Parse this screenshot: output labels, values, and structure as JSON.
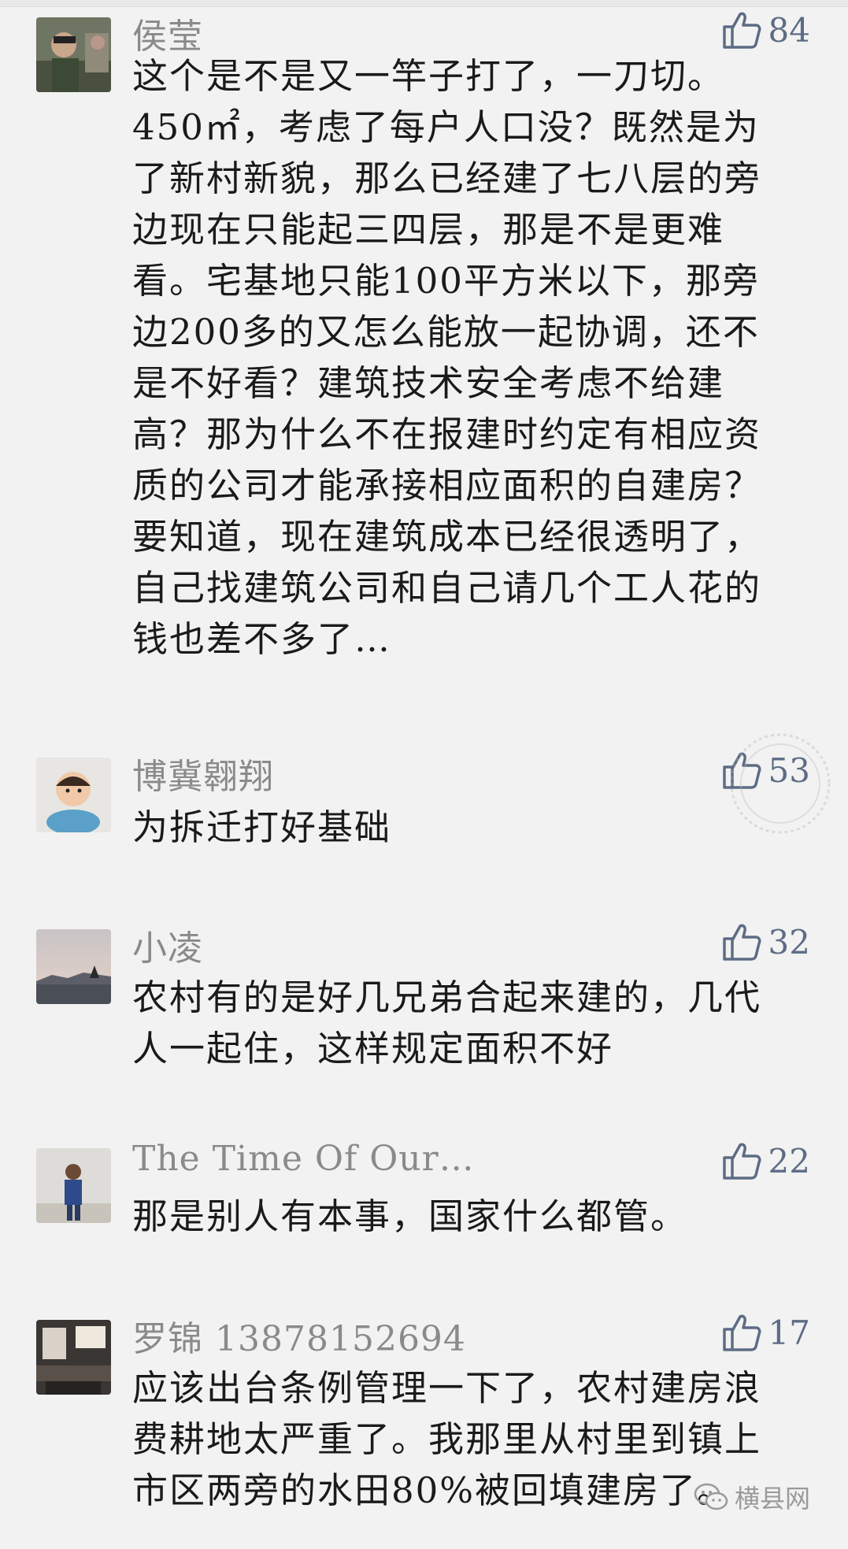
{
  "comments": [
    {
      "name": "侯莹",
      "likes": "84",
      "lines": [
        "这个是不是又一竿子打了，一刀切。",
        "450㎡，考虑了每户人口没？既然是为",
        "了新村新貌，那么已经建了七八层的旁",
        "边现在只能起三四层，那是不是更难",
        "看。宅基地只能100平方米以下，那旁",
        "边200多的又怎么能放一起协调，还不",
        "是不好看？建筑技术安全考虑不给建",
        "高？那为什么不在报建时约定有相应资",
        "质的公司才能承接相应面积的自建房？",
        "要知道，现在建筑成本已经很透明了，",
        "自己找建筑公司和自己请几个工人花的",
        "钱也差不多了…"
      ]
    },
    {
      "name": "博冀翱翔",
      "likes": "53",
      "lines": [
        "为拆迁打好基础"
      ]
    },
    {
      "name": "小凌",
      "likes": "32",
      "lines": [
        "农村有的是好几兄弟合起来建的，几代",
        "人一起住，这样规定面积不好"
      ]
    },
    {
      "name": "The Time Of Our…",
      "likes": "22",
      "lines": [
        "那是别人有本事，国家什么都管。"
      ]
    },
    {
      "name": "罗锦 13878152694",
      "likes": "17",
      "lines": [
        "应该出台条例管理一下了，农村建房浪",
        "费耕地太严重了。我那里从村里到镇上",
        "市区两旁的水田80%被回填建房了。"
      ]
    }
  ],
  "brand": "横县网",
  "colors": {
    "background": "#f2f2f2",
    "name": "#8a8a8a",
    "like": "#5d6c84",
    "text": "#1a1a1a"
  },
  "icons": [
    "thumbs-up-icon",
    "wechat-icon"
  ]
}
